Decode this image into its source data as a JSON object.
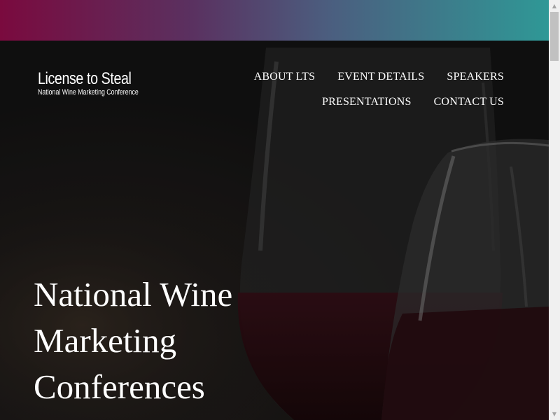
{
  "colors": {
    "gradient_start": "#7a0a3e",
    "gradient_mid": "#4b5e7f",
    "gradient_end": "#2f9896",
    "text": "#ffffff"
  },
  "logo": {
    "title": "License to Steal",
    "subtitle": "National Wine Marketing Conference"
  },
  "nav": {
    "row1": [
      {
        "label": "ABOUT LTS"
      },
      {
        "label": "EVENT DETAILS"
      },
      {
        "label": "SPEAKERS"
      }
    ],
    "row2": [
      {
        "label": "PRESENTATIONS"
      },
      {
        "label": "CONTACT US"
      }
    ]
  },
  "hero": {
    "headline_line1": "National Wine",
    "headline_line2": "Marketing",
    "headline_line3": "Conferences",
    "image_alt": "wine-glasses-photo"
  },
  "scrollbar": {
    "up_icon": "scroll-up-arrow-icon",
    "down_icon": "scroll-down-arrow-icon"
  }
}
